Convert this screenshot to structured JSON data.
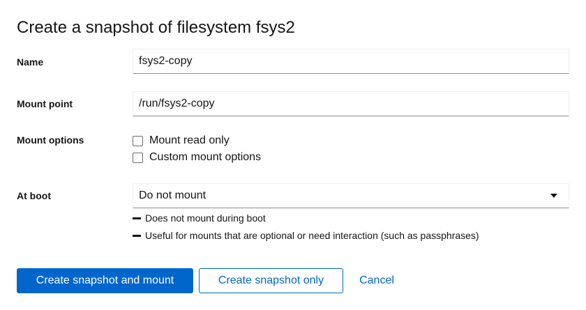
{
  "dialog": {
    "title": "Create a snapshot of filesystem fsys2"
  },
  "form": {
    "name": {
      "label": "Name",
      "value": "fsys2-copy"
    },
    "mount_point": {
      "label": "Mount point",
      "value": "/run/fsys2-copy"
    },
    "mount_options": {
      "label": "Mount options",
      "options": [
        {
          "label": "Mount read only",
          "checked": false
        },
        {
          "label": "Custom mount options",
          "checked": false
        }
      ]
    },
    "at_boot": {
      "label": "At boot",
      "selected": "Do not mount",
      "helper_text": [
        "Does not mount during boot",
        "Useful for mounts that are optional or need interaction (such as passphrases)"
      ]
    }
  },
  "actions": {
    "primary": "Create snapshot and mount",
    "secondary": "Create snapshot only",
    "cancel": "Cancel"
  },
  "colors": {
    "accent": "#0066cc",
    "text": "#151515",
    "border": "#8a8d90"
  },
  "icons": {
    "select_caret": "caret-down-icon",
    "helper_bullet": "dash-icon"
  }
}
